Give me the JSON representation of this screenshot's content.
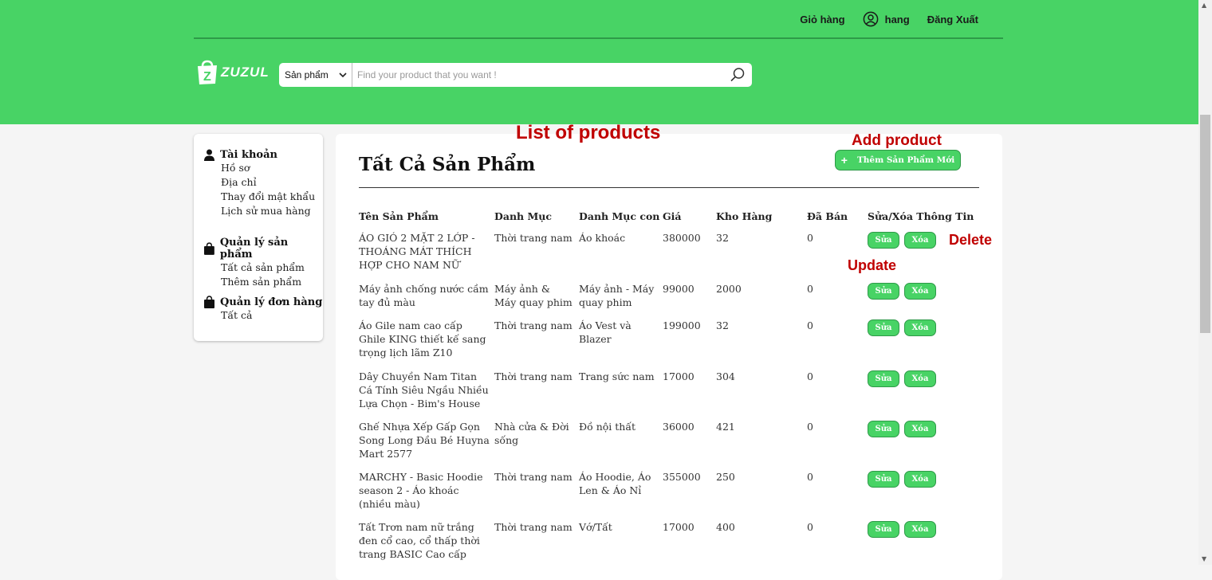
{
  "header": {
    "cart_label": "Giỏ hàng",
    "user_label": "hang",
    "logout_label": "Đăng Xuất",
    "logo_text": "ZUZUL",
    "search_category": "Sản phẩm",
    "search_placeholder": "Find your product that you want !"
  },
  "sidebar": {
    "account": {
      "title": "Tài khoản",
      "items": [
        "Hồ sơ",
        "Địa chỉ",
        "Thay đổi mật khẩu",
        "Lịch sử mua hàng"
      ]
    },
    "products": {
      "title": "Quản lý sản phẩm",
      "items": [
        "Tất cả sản phẩm",
        "Thêm sản phẩm"
      ]
    },
    "orders": {
      "title": "Quản lý đơn hàng",
      "items": [
        "Tất cả"
      ]
    }
  },
  "main": {
    "title": "Tất Cả Sản Phẩm",
    "add_button_label": "Thêm Sản Phẩm Mới",
    "columns": [
      "Tên Sản Phẩm",
      "Danh Mục",
      "Danh Mục con",
      "Giá",
      "Kho Hàng",
      "Đã Bán",
      "Sửa/Xóa Thông Tin"
    ],
    "edit_label": "Sửa",
    "delete_label": "Xóa",
    "rows": [
      {
        "name": "ÁO GIÓ 2 MẶT 2 LỚP - THOÁNG MÁT THÍCH HỢP CHO NAM NỮ",
        "category": "Thời trang nam",
        "subcategory": "Áo khoác",
        "price": "380000",
        "stock": "32",
        "sold": "0"
      },
      {
        "name": "Máy ảnh chống nước cầm tay đủ màu",
        "category": "Máy ảnh & Máy quay phim",
        "subcategory": "Máy ảnh - Máy quay phim",
        "price": "99000",
        "stock": "2000",
        "sold": "0"
      },
      {
        "name": "Áo Gile nam cao cấp Ghile KING thiết kế sang trọng lịch lãm Z10",
        "category": "Thời trang nam",
        "subcategory": "Áo Vest và Blazer",
        "price": "199000",
        "stock": "32",
        "sold": "0"
      },
      {
        "name": "Dây Chuyền Nam Titan Cá Tính Siêu Ngầu Nhiều Lựa Chọn - Bim's House",
        "category": "Thời trang nam",
        "subcategory": "Trang sức nam",
        "price": "17000",
        "stock": "304",
        "sold": "0"
      },
      {
        "name": "Ghế Nhựa Xếp Gấp Gọn Song Long Đầu Bé Huyna Mart 2577",
        "category": "Nhà cửa & Đời sống",
        "subcategory": "Đồ nội thất",
        "price": "36000",
        "stock": "421",
        "sold": "0"
      },
      {
        "name": "MARCHY - Basic Hoodie season 2 - Áo khoác (nhiều màu)",
        "category": "Thời trang nam",
        "subcategory": "Áo Hoodie, Áo Len & Áo Nỉ",
        "price": "355000",
        "stock": "250",
        "sold": "0"
      },
      {
        "name": "Tất Trơn nam nữ trắng đen cổ cao, cổ thấp thời trang BASIC Cao cấp",
        "category": "Thời trang nam",
        "subcategory": "Vớ/Tất",
        "price": "17000",
        "stock": "400",
        "sold": "0"
      }
    ]
  },
  "annotations": {
    "list": "List of products",
    "add": "Add product",
    "delete": "Delete",
    "update": "Update"
  },
  "colors": {
    "brand_green": "#48d365",
    "annotation_red": "#c00000"
  }
}
